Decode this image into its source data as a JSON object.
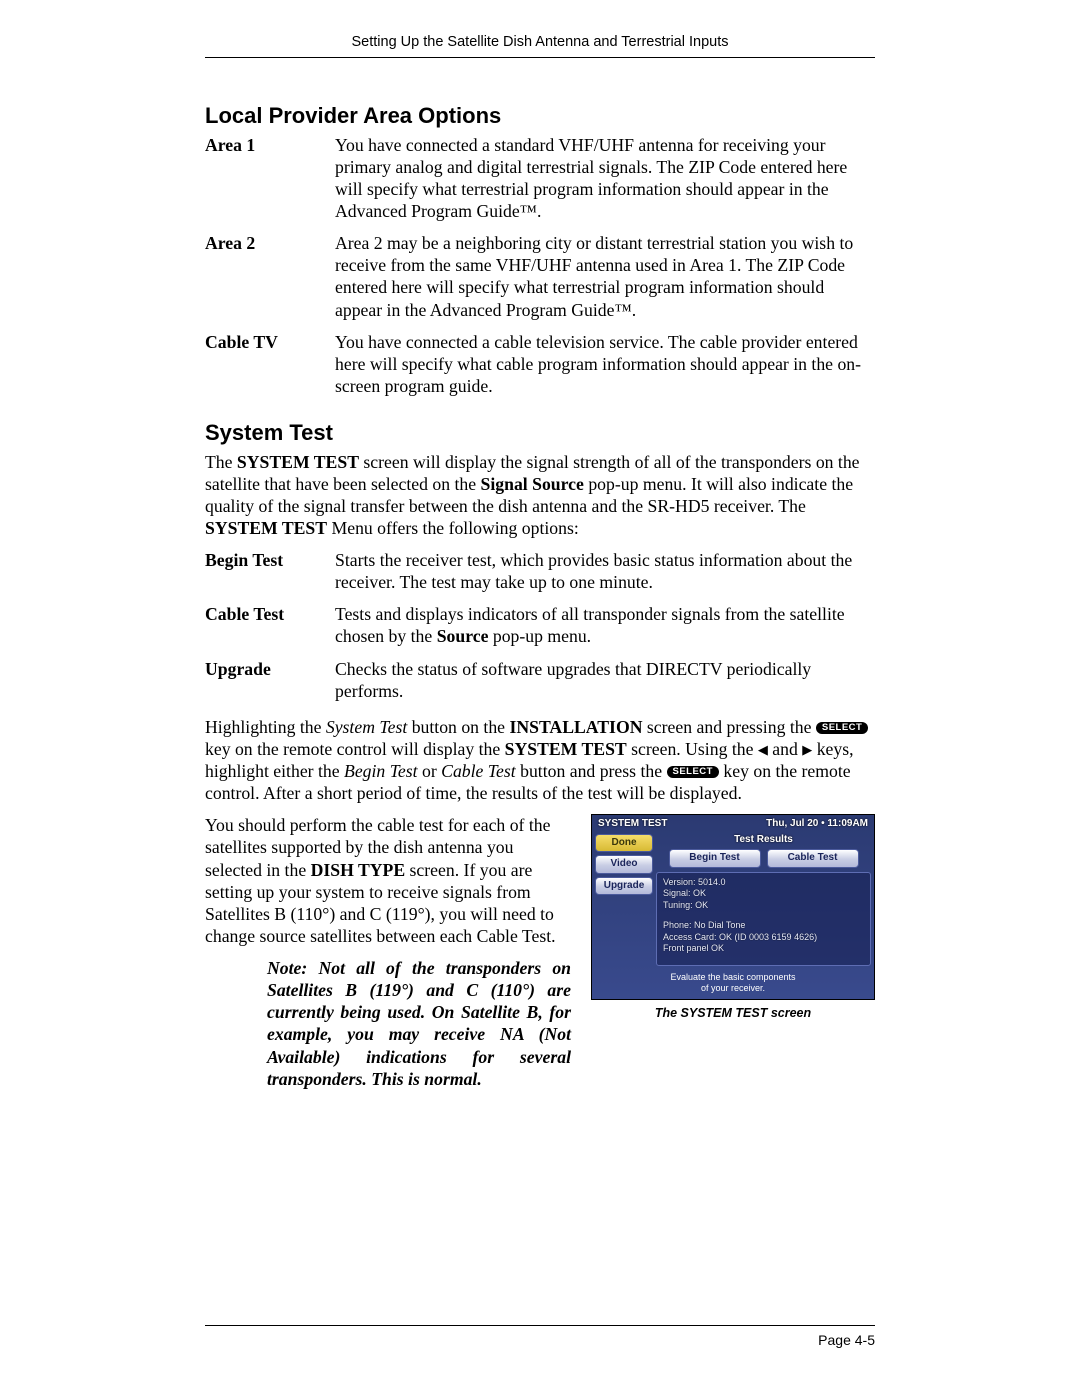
{
  "running_head": "Setting Up the Satellite Dish Antenna and Terrestrial Inputs",
  "sections": {
    "local_provider": {
      "title": "Local Provider Area Options",
      "items": [
        {
          "term": "Area 1",
          "desc": "You have connected a standard VHF/UHF antenna for receiving your primary analog and digital terrestrial signals. The ZIP Code entered here will specify what terrestrial program information should appear in the Advanced Program Guide™."
        },
        {
          "term": "Area 2",
          "desc": "Area 2 may be a neighboring city or distant terrestrial station you wish to receive from the same VHF/UHF antenna used in Area 1. The ZIP Code entered here will specify what terrestrial program information should appear in the Advanced Program Guide™."
        },
        {
          "term": "Cable TV",
          "desc": "You have connected a cable television service. The cable provider entered here will specify what cable program information should appear in the on-screen program guide."
        }
      ]
    },
    "system_test": {
      "title": "System Test",
      "intro": {
        "p1a": "The ",
        "p1b": "SYSTEM TEST",
        "p1c": " screen will display the signal strength of all of the transponders on the satellite that have been selected on the ",
        "p1d": "Signal Source",
        "p1e": " pop-up menu. It will also indicate the quality of the signal transfer between the dish antenna and the SR-HD5 receiver. The ",
        "p1f": "SYSTEM TEST",
        "p1g": " Menu offers the following options:"
      },
      "items": [
        {
          "term": "Begin Test",
          "desc": "Starts the receiver test, which provides basic status information about the receiver. The test may take up to one minute."
        },
        {
          "term": "Cable Test",
          "desc_pre": "Tests and displays indicators of all transponder signals from the satellite chosen by the ",
          "desc_bold": "Source",
          "desc_post": " pop-up menu."
        },
        {
          "term": "Upgrade",
          "desc": "Checks the status of software upgrades that DIRECTV periodically performs."
        }
      ],
      "para2": {
        "a": "Highlighting the ",
        "b": "System Test",
        "c": " button on the ",
        "d": "INSTALLATION",
        "e": " screen and pressing the ",
        "select1": "SELECT",
        "f": " key on the remote control will display the ",
        "g": "SYSTEM TEST",
        "h": " screen. Using the ",
        "left": "◀",
        "and": " and ",
        "right": "▶",
        "i": " keys, highlight either the ",
        "j": "Begin Test",
        "k": " or ",
        "l": "Cable Test",
        "m": " button and press the ",
        "select2": "SELECT",
        "n": " key on the remote control. After a short period of time, the results of the test will be displayed."
      },
      "para3": {
        "a": "You should perform the cable test for each of the satellites supported by the dish antenna you selected in the ",
        "b": "DISH TYPE",
        "c": " screen. If you are setting up your system to receive signals from Satellites B (110°) and C (119°), you will need to change source satellites between each Cable Test."
      },
      "note": "Note: Not all of the transponders on Satellites B (119°) and C (110°) are currently being used. On Satellite B, for example, you may receive NA (Not Available) indications for several transponders. This is normal."
    }
  },
  "screenshot": {
    "title": "SYSTEM TEST",
    "clock": "Thu, Jul 20 • 11:09AM",
    "subtitle": "Test Results",
    "side": [
      "Done",
      "Video",
      "Upgrade"
    ],
    "tabs": [
      "Begin Test",
      "Cable Test"
    ],
    "lines1": [
      "Version: 5014.0",
      "Signal: OK",
      "Tuning: OK"
    ],
    "lines2": [
      "Phone: No Dial Tone",
      "Access Card: OK (ID 0003 6159 4626)",
      "Front panel OK"
    ],
    "footer1": "Evaluate the basic components",
    "footer2": "of your receiver.",
    "caption": "The SYSTEM TEST screen"
  },
  "page_number": "Page 4-5"
}
